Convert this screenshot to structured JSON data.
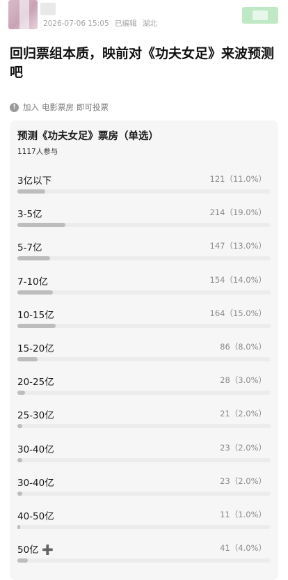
{
  "post": {
    "timestamp": "2026-07-06 15:05",
    "edited": "已编辑",
    "location": "湖北",
    "title": "回归票组本质，映前对《功夫女足》来波预测吧"
  },
  "topic": {
    "prefix": "加入",
    "name": "电影票房",
    "suffix": "即可投票",
    "icon": "info-icon"
  },
  "poll": {
    "title": "预测《功夫女足》票房（单选）",
    "participants": "1117人参与",
    "options": [
      {
        "label": "3亿以下",
        "stat": "121（11.0%）",
        "percent": 11.0
      },
      {
        "label": "3-5亿",
        "stat": "214（19.0%）",
        "percent": 19.0
      },
      {
        "label": "5-7亿",
        "stat": "147（13.0%）",
        "percent": 13.0
      },
      {
        "label": "7-10亿",
        "stat": "154（14.0%）",
        "percent": 14.0
      },
      {
        "label": "10-15亿",
        "stat": "164（15.0%）",
        "percent": 15.0
      },
      {
        "label": "15-20亿",
        "stat": "86（8.0%）",
        "percent": 8.0
      },
      {
        "label": "20-25亿",
        "stat": "28（3.0%）",
        "percent": 3.0
      },
      {
        "label": "25-30亿",
        "stat": "21（2.0%）",
        "percent": 2.0
      },
      {
        "label": "30-40亿",
        "stat": "23（2.0%）",
        "percent": 2.0
      },
      {
        "label": "30-40亿",
        "stat": "23（2.0%）",
        "percent": 2.0
      },
      {
        "label": "40-50亿",
        "stat": "11（1.0%）",
        "percent": 1.0
      },
      {
        "label": "50亿 ➕",
        "stat": "41（4.0%）",
        "percent": 4.0
      }
    ]
  },
  "colors": {
    "fill": "#bdbdbd",
    "track": "#ececec",
    "card_bg": "#f6f6f6",
    "follow_button": "#bfe8c5"
  }
}
